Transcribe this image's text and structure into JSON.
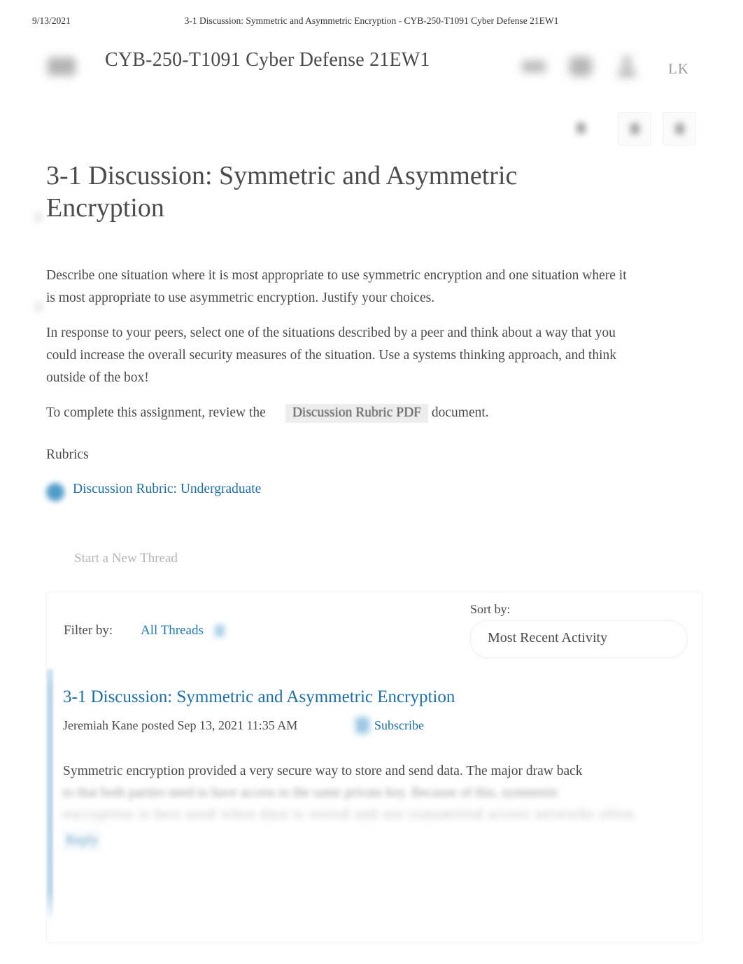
{
  "print_header": {
    "date": "9/13/2021",
    "title": "3-1 Discussion: Symmetric and Asymmetric Encryption - CYB-250-T1091 Cyber Defense 21EW1"
  },
  "navbar": {
    "logo_icon": "course-logo-icon",
    "course_title": "CYB-250-T1091 Cyber Defense 21EW1",
    "alerts_icon": "alerts-bell-icon",
    "messages_icon": "messages-icon",
    "profile_icon": "profile-person-icon",
    "user_initials": "LK"
  },
  "tool_strip": {
    "buttons": [
      {
        "icon": "print-icon"
      },
      {
        "icon": "settings-icon"
      },
      {
        "icon": "help-icon"
      }
    ]
  },
  "page": {
    "title": "3-1 Discussion: Symmetric and Asymmetric Encryption"
  },
  "description": {
    "paragraph_1": "Describe one situation where it is most appropriate to use symmetric encryption and one situation where it is most appropriate to use asymmetric encryption. Justify your choices.",
    "paragraph_2": "In response to your peers, select one of the situations described by a peer and think about a way that you could increase the overall security measures of the situation. Use a systems thinking approach, and think outside of the box!",
    "paragraph_3_prefix": "To complete this assignment, review the",
    "rubric_pdf_link": "Discussion Rubric PDF",
    "paragraph_3_suffix": " document."
  },
  "rubrics": {
    "heading": "Rubrics",
    "icon": "rubric-icon",
    "link": "Discussion Rubric: Undergraduate"
  },
  "actions": {
    "start_new_thread": "Start a New Thread"
  },
  "discussion_controls": {
    "filter_label": "Filter by:",
    "filter_value": "All Threads",
    "filter_chevron_icon": "chevron-down-icon",
    "sort_label": "Sort by:",
    "sort_value": "Most Recent Activity",
    "sort_options": [
      "Most Recent Activity"
    ]
  },
  "thread": {
    "title": "3-1 Discussion: Symmetric and Asymmetric Encryption",
    "meta": "Jeremiah Kane posted Sep 13, 2021 11:35 AM",
    "subscribe_icon": "subscribe-bell-icon",
    "subscribe_label": "Subscribe",
    "body_line_1": "Symmetric encryption provided a very secure way to store and send data. The major draw back",
    "body_line_2_obscured": "to that both parties need to have access to the same private key. Because of this, symmetric",
    "body_line_3_obscured": "encryption is best used when data is stored and not transmitted across networks often.",
    "body_footer_obscured": "Reply"
  },
  "colors": {
    "link_blue": "#1a6fa8",
    "accent_blue": "#bcd8ea",
    "text_gray": "#4a4a4a",
    "muted_gray": "#b4b4b4",
    "page_background": "#ffffff"
  }
}
